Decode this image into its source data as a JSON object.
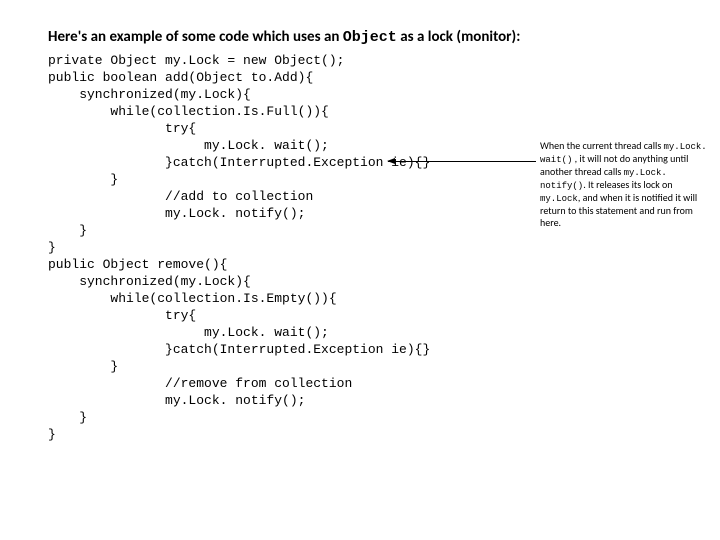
{
  "heading": {
    "prefix": "Here's an example of some code which uses an ",
    "mono": "Object",
    "suffix": " as a lock (monitor):"
  },
  "code": "private Object my.Lock = new Object();\npublic boolean add(Object to.Add){\n    synchronized(my.Lock){\n        while(collection.Is.Full()){\n               try{\n                    my.Lock. wait();\n               }catch(Interrupted.Exception ie){}\n        }\n               //add to collection\n               my.Lock. notify();\n    }\n}\npublic Object remove(){\n    synchronized(my.Lock){\n        while(collection.Is.Empty()){\n               try{\n                    my.Lock. wait();\n               }catch(Interrupted.Exception ie){}\n        }\n               //remove from collection\n               my.Lock. notify();\n    }\n}",
  "annotation": {
    "t1": "When the current thread calls ",
    "m1": "my.Lock. wait()",
    "t2": " , it will not do anything until another thread calls ",
    "m2": "my.Lock. notify()",
    "t3": ". It releases its lock on ",
    "m3": "my.Lock",
    "t4": ", and when it is notified it will return to this statement and run from here."
  }
}
